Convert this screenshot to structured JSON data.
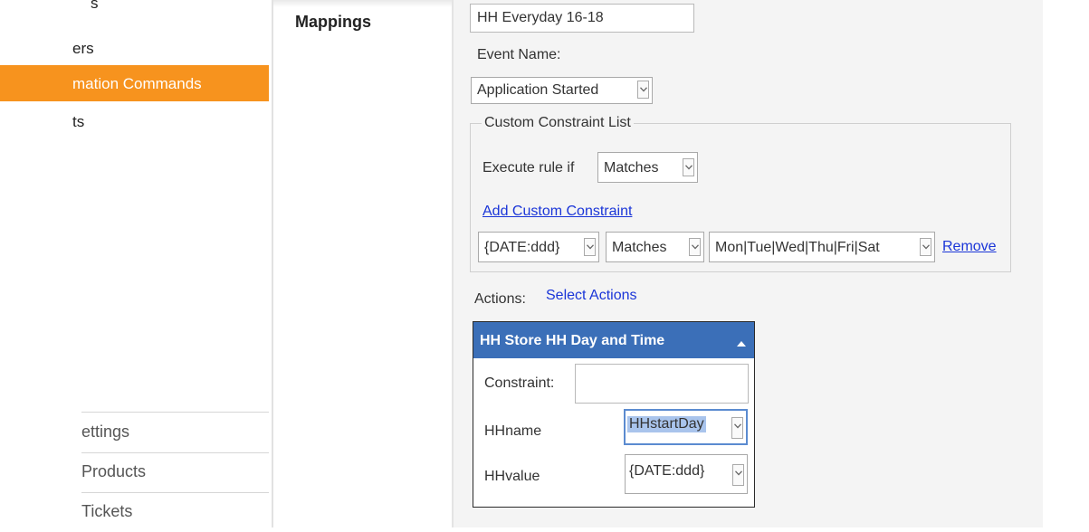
{
  "sidebar": {
    "items": [
      {
        "label": "s"
      },
      {
        "label": "ers"
      },
      {
        "label": "mation Commands"
      },
      {
        "label": "ts"
      }
    ],
    "bottom_items": [
      {
        "label": "ettings"
      },
      {
        "label": "Products"
      },
      {
        "label": "Tickets"
      }
    ]
  },
  "section": {
    "title": "Mappings"
  },
  "form": {
    "name_value": "HH Everyday 16-18",
    "event_label": "Event Name:",
    "event_value": "Application Started",
    "constraint_list": {
      "legend": "Custom Constraint List",
      "execute_label": "Execute rule if",
      "execute_value": "Matches",
      "add_link": "Add Custom Constraint",
      "row": {
        "field": "{DATE:ddd}",
        "operator": "Matches",
        "value": "Mon|Tue|Wed|Thu|Fri|Sat",
        "remove": "Remove"
      }
    },
    "actions_label": "Actions:",
    "select_actions": "Select Actions"
  },
  "action_card": {
    "title": "HH Store HH Day and Time",
    "constraint_label": "Constraint:",
    "constraint_value": "",
    "fields": [
      {
        "label": "HHname",
        "value": "HHstartDay"
      },
      {
        "label": "HHvalue",
        "value": "{DATE:ddd}"
      }
    ]
  },
  "colors": {
    "active_item": "#f7931e",
    "card_header": "#3b6fb8",
    "link": "#1a35d8",
    "selection": "#a9c4ec"
  },
  "icons": [
    "chevron-down-icon",
    "caret-up-icon"
  ]
}
